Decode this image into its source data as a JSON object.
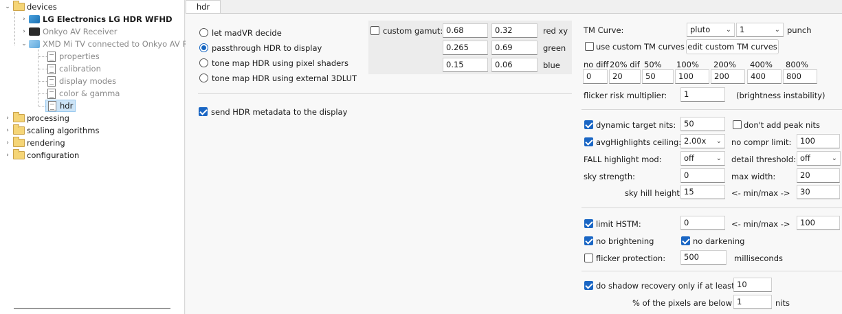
{
  "tree": {
    "devices": "devices",
    "lg": "LG Electronics LG HDR WFHD",
    "onkyo": "Onkyo AV Receiver",
    "xmd": "XMD Mi TV connected to Onkyo AV R.",
    "properties": "properties",
    "calibration": "calibration",
    "display_modes": "display modes",
    "color_gamma": "color & gamma",
    "hdr": "hdr",
    "processing": "processing",
    "scaling": "scaling algorithms",
    "rendering": "rendering",
    "configuration": "configuration"
  },
  "tab": {
    "label": "hdr"
  },
  "mode": {
    "options": [
      "let madVR decide",
      "passthrough HDR to display",
      "tone map HDR using pixel shaders",
      "tone map HDR using external 3DLUT"
    ],
    "selected_index": 1
  },
  "send_metadata": {
    "label": "send HDR metadata to the display",
    "checked": true
  },
  "gamut": {
    "label": "custom gamut:",
    "checked": false,
    "rows": [
      {
        "x": "0.68",
        "y": "0.32",
        "name": "red xy"
      },
      {
        "x": "0.265",
        "y": "0.69",
        "name": "green"
      },
      {
        "x": "0.15",
        "y": "0.06",
        "name": "blue"
      }
    ]
  },
  "tm": {
    "curve_label": "TM Curve:",
    "curve_value": "pluto",
    "curve_num": "1",
    "punch_label": "punch",
    "custom_label": "use custom TM curves",
    "custom_checked": false,
    "edit_button": "edit custom TM curves",
    "curve_headers": [
      "no diff",
      "20% dif",
      "50%",
      "100%",
      "200%",
      "400%",
      "800%"
    ],
    "curve_values": [
      "0",
      "20",
      "50",
      "100",
      "200",
      "400",
      "800"
    ],
    "flicker_label": "flicker risk multiplier:",
    "flicker_value": "1",
    "flicker_note": "(brightness instability)"
  },
  "dyn": {
    "dynamic_label": "dynamic target nits:",
    "dynamic_checked": true,
    "dynamic_value": "50",
    "no_peak_label": "don't add peak nits",
    "no_peak_checked": false,
    "avg_label": "avgHighlights ceiling:",
    "avg_checked": true,
    "avg_value": "2.00x",
    "no_compr_label": "no compr limit:",
    "no_compr_value": "100",
    "fall_label": "FALL highlight mod:",
    "fall_value": "off",
    "detail_label": "detail threshold:",
    "detail_value": "off",
    "sky_label": "sky strength:",
    "sky_value": "0",
    "max_width_label": "max width:",
    "max_width_value": "20",
    "skyhill_label": "sky hill height:",
    "skyhill_value": "15",
    "minmax_label": "<- min/max ->",
    "skyhill_max": "30"
  },
  "hstm": {
    "limit_label": "limit HSTM:",
    "limit_checked": true,
    "limit_min": "0",
    "minmax_label": "<- min/max ->",
    "limit_max": "100",
    "no_bright_label": "no brightening",
    "no_bright_checked": true,
    "no_dark_label": "no darkening",
    "no_dark_checked": true,
    "flicker_label": "flicker protection:",
    "flicker_checked": false,
    "flicker_value": "500",
    "ms_label": "milliseconds"
  },
  "shadow": {
    "label": "do shadow recovery only if at least",
    "checked": true,
    "value1": "10",
    "label2": "% of the pixels are below",
    "value2": "1",
    "units": "nits"
  }
}
